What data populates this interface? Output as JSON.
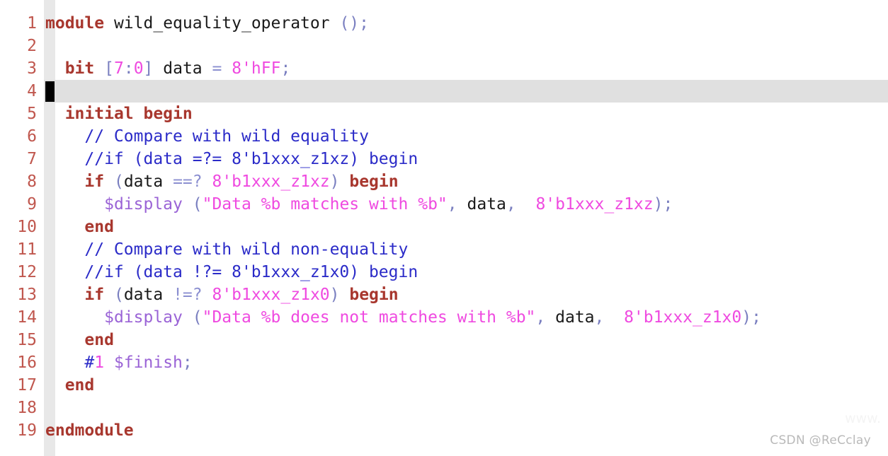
{
  "editor": {
    "language": "SystemVerilog",
    "active_line": 4,
    "cursor_column": 1,
    "colors": {
      "background": "#ffffff",
      "gutter_band": "#e8e8e8",
      "active_line": "#e0e0e0",
      "line_number": "#c0574e",
      "keyword": "#a8372e",
      "identifier": "#1a1a1a",
      "punctuation": "#7a7fc0",
      "number": "#ef4ae0",
      "literal": "#ef4ae0",
      "string": "#ef4ae0",
      "comment": "#2b2bc8",
      "system_task": "#9a63d6",
      "operator": "#8b8fd0",
      "cursor": "#000000"
    },
    "lines": [
      {
        "n": "1",
        "tokens": [
          {
            "t": "kw",
            "v": "module"
          },
          {
            "t": "plain",
            "v": " "
          },
          {
            "t": "ident",
            "v": "wild_equality_operator"
          },
          {
            "t": "plain",
            "v": " "
          },
          {
            "t": "punc",
            "v": "();"
          }
        ]
      },
      {
        "n": "2",
        "tokens": []
      },
      {
        "n": "3",
        "tokens": [
          {
            "t": "plain",
            "v": "  "
          },
          {
            "t": "kw",
            "v": "bit"
          },
          {
            "t": "plain",
            "v": " "
          },
          {
            "t": "punc",
            "v": "["
          },
          {
            "t": "num",
            "v": "7"
          },
          {
            "t": "punc",
            "v": ":"
          },
          {
            "t": "num",
            "v": "0"
          },
          {
            "t": "punc",
            "v": "]"
          },
          {
            "t": "plain",
            "v": " "
          },
          {
            "t": "ident",
            "v": "data"
          },
          {
            "t": "plain",
            "v": " "
          },
          {
            "t": "op",
            "v": "="
          },
          {
            "t": "plain",
            "v": " "
          },
          {
            "t": "lit",
            "v": "8'hFF"
          },
          {
            "t": "punc",
            "v": ";"
          }
        ]
      },
      {
        "n": "4",
        "tokens": []
      },
      {
        "n": "5",
        "tokens": [
          {
            "t": "plain",
            "v": "  "
          },
          {
            "t": "kw",
            "v": "initial begin"
          }
        ]
      },
      {
        "n": "6",
        "tokens": [
          {
            "t": "plain",
            "v": "    "
          },
          {
            "t": "cmt",
            "v": "// Compare with wild equality"
          }
        ]
      },
      {
        "n": "7",
        "tokens": [
          {
            "t": "plain",
            "v": "    "
          },
          {
            "t": "cmt",
            "v": "//if (data =?= 8'b1xxx_z1xz) begin"
          }
        ]
      },
      {
        "n": "8",
        "tokens": [
          {
            "t": "plain",
            "v": "    "
          },
          {
            "t": "kw",
            "v": "if"
          },
          {
            "t": "plain",
            "v": " "
          },
          {
            "t": "punc",
            "v": "("
          },
          {
            "t": "ident",
            "v": "data"
          },
          {
            "t": "plain",
            "v": " "
          },
          {
            "t": "op",
            "v": "==?"
          },
          {
            "t": "plain",
            "v": " "
          },
          {
            "t": "lit",
            "v": "8'b1xxx_z1xz"
          },
          {
            "t": "punc",
            "v": ")"
          },
          {
            "t": "plain",
            "v": " "
          },
          {
            "t": "kw",
            "v": "begin"
          }
        ]
      },
      {
        "n": "9",
        "tokens": [
          {
            "t": "plain",
            "v": "      "
          },
          {
            "t": "sys",
            "v": "$display"
          },
          {
            "t": "plain",
            "v": " "
          },
          {
            "t": "punc",
            "v": "("
          },
          {
            "t": "str",
            "v": "\"Data %b matches with %b\""
          },
          {
            "t": "punc",
            "v": ","
          },
          {
            "t": "plain",
            "v": " "
          },
          {
            "t": "ident",
            "v": "data"
          },
          {
            "t": "punc",
            "v": ","
          },
          {
            "t": "plain",
            "v": "  "
          },
          {
            "t": "lit",
            "v": "8'b1xxx_z1xz"
          },
          {
            "t": "punc",
            "v": ");"
          }
        ]
      },
      {
        "n": "10",
        "tokens": [
          {
            "t": "plain",
            "v": "    "
          },
          {
            "t": "kw",
            "v": "end"
          }
        ]
      },
      {
        "n": "11",
        "tokens": [
          {
            "t": "plain",
            "v": "    "
          },
          {
            "t": "cmt",
            "v": "// Compare with wild non-equality"
          }
        ]
      },
      {
        "n": "12",
        "tokens": [
          {
            "t": "plain",
            "v": "    "
          },
          {
            "t": "cmt",
            "v": "//if (data !?= 8'b1xxx_z1x0) begin"
          }
        ]
      },
      {
        "n": "13",
        "tokens": [
          {
            "t": "plain",
            "v": "    "
          },
          {
            "t": "kw",
            "v": "if"
          },
          {
            "t": "plain",
            "v": " "
          },
          {
            "t": "punc",
            "v": "("
          },
          {
            "t": "ident",
            "v": "data"
          },
          {
            "t": "plain",
            "v": " "
          },
          {
            "t": "op",
            "v": "!=?"
          },
          {
            "t": "plain",
            "v": " "
          },
          {
            "t": "lit",
            "v": "8'b1xxx_z1x0"
          },
          {
            "t": "punc",
            "v": ")"
          },
          {
            "t": "plain",
            "v": " "
          },
          {
            "t": "kw",
            "v": "begin"
          }
        ]
      },
      {
        "n": "14",
        "tokens": [
          {
            "t": "plain",
            "v": "      "
          },
          {
            "t": "sys",
            "v": "$display"
          },
          {
            "t": "plain",
            "v": " "
          },
          {
            "t": "punc",
            "v": "("
          },
          {
            "t": "str",
            "v": "\"Data %b does not matches with %b\""
          },
          {
            "t": "punc",
            "v": ","
          },
          {
            "t": "plain",
            "v": " "
          },
          {
            "t": "ident",
            "v": "data"
          },
          {
            "t": "punc",
            "v": ","
          },
          {
            "t": "plain",
            "v": "  "
          },
          {
            "t": "lit",
            "v": "8'b1xxx_z1x0"
          },
          {
            "t": "punc",
            "v": ");"
          }
        ]
      },
      {
        "n": "15",
        "tokens": [
          {
            "t": "plain",
            "v": "    "
          },
          {
            "t": "kw",
            "v": "end"
          }
        ]
      },
      {
        "n": "16",
        "tokens": [
          {
            "t": "plain",
            "v": "    "
          },
          {
            "t": "cmt",
            "v": "#"
          },
          {
            "t": "num",
            "v": "1"
          },
          {
            "t": "plain",
            "v": " "
          },
          {
            "t": "sys",
            "v": "$finish"
          },
          {
            "t": "punc",
            "v": ";"
          }
        ]
      },
      {
        "n": "17",
        "tokens": [
          {
            "t": "plain",
            "v": "  "
          },
          {
            "t": "kw",
            "v": "end"
          }
        ]
      },
      {
        "n": "18",
        "tokens": []
      },
      {
        "n": "19",
        "tokens": [
          {
            "t": "kw",
            "v": "endmodule"
          }
        ]
      }
    ]
  },
  "watermark": {
    "text": "CSDN @ReCclay",
    "url_ghost": "www."
  }
}
